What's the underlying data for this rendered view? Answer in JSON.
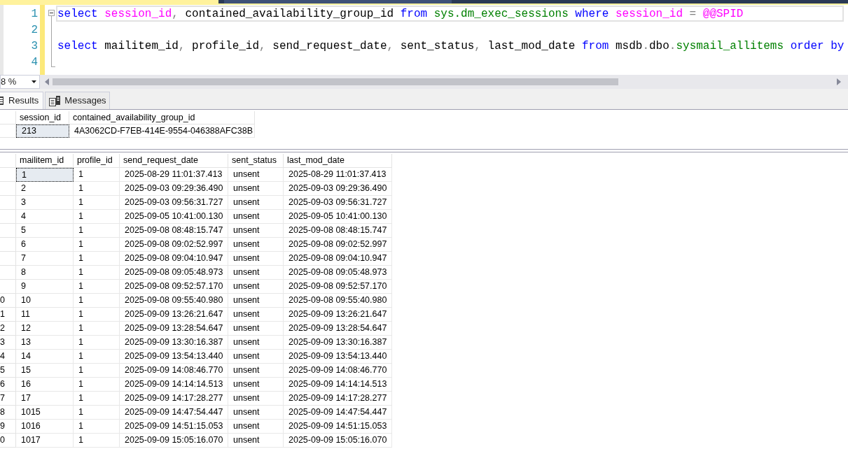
{
  "document_tabs": [
    {
      "selected": true
    },
    {
      "selected": false
    }
  ],
  "editor": {
    "changed": true,
    "fold_region": {
      "expanded": true
    },
    "lines": [
      {
        "number": "1",
        "current": true,
        "tokens": [
          {
            "text": "select",
            "kind": "keyword"
          },
          {
            "text": " session_id",
            "kind": "function"
          },
          {
            "text": ",",
            "kind": "operator"
          },
          {
            "text": " contained_availability_group_id ",
            "kind": "plain"
          },
          {
            "text": "from",
            "kind": "keyword"
          },
          {
            "text": " sys.dm_exec_sessions",
            "kind": "object"
          },
          {
            "text": " where",
            "kind": "keyword"
          },
          {
            "text": " session_id",
            "kind": "function"
          },
          {
            "text": " =",
            "kind": "operator"
          },
          {
            "text": " @@SPID",
            "kind": "function"
          }
        ]
      },
      {
        "number": "2",
        "current": false
      },
      {
        "number": "3",
        "current": false,
        "tokens": [
          {
            "text": "select",
            "kind": "keyword"
          },
          {
            "text": " mailitem_id",
            "kind": "plain"
          },
          {
            "text": ",",
            "kind": "operator"
          },
          {
            "text": " profile_id",
            "kind": "plain"
          },
          {
            "text": ",",
            "kind": "operator"
          },
          {
            "text": " send_request_date",
            "kind": "plain"
          },
          {
            "text": ",",
            "kind": "operator"
          },
          {
            "text": " sent_status",
            "kind": "plain"
          },
          {
            "text": ",",
            "kind": "operator"
          },
          {
            "text": " last_mod_date ",
            "kind": "plain"
          },
          {
            "text": "from",
            "kind": "keyword"
          },
          {
            "text": " msdb",
            "kind": "plain"
          },
          {
            "text": ".",
            "kind": "operator"
          },
          {
            "text": "dbo",
            "kind": "plain"
          },
          {
            "text": ".",
            "kind": "operator"
          },
          {
            "text": "sysmail_allitems",
            "kind": "object"
          },
          {
            "text": " order by",
            "kind": "keyword"
          }
        ]
      },
      {
        "number": "4",
        "current": false
      }
    ]
  },
  "zoom": {
    "value": "8 %"
  },
  "results_tabs": [
    {
      "label": "Results",
      "kind": "results",
      "selected": true
    },
    {
      "label": "Messages",
      "kind": "messages",
      "selected": false
    }
  ],
  "grids": [
    {
      "columns": [
        "session_id",
        "contained_availability_group_id"
      ],
      "rows": [
        {
          "cells": [
            "213",
            "4A3062CD-F7EB-414E-9554-046388AFC38B"
          ],
          "selected": true
        }
      ]
    },
    {
      "columns": [
        "mailitem_id",
        "profile_id",
        "send_request_date",
        "sent_status",
        "last_mod_date"
      ],
      "rows": [
        {
          "cells": [
            "1",
            "1",
            "2025-08-29 11:01:37.413",
            "unsent",
            "2025-08-29 11:01:37.413"
          ],
          "selected": true
        },
        {
          "cells": [
            "2",
            "1",
            "2025-09-03 09:29:36.490",
            "unsent",
            "2025-09-03 09:29:36.490"
          ],
          "selected": false
        },
        {
          "cells": [
            "3",
            "1",
            "2025-09-03 09:56:31.727",
            "unsent",
            "2025-09-03 09:56:31.727"
          ],
          "selected": false
        },
        {
          "cells": [
            "4",
            "1",
            "2025-09-05 10:41:00.130",
            "unsent",
            "2025-09-05 10:41:00.130"
          ],
          "selected": false
        },
        {
          "cells": [
            "5",
            "1",
            "2025-09-08 08:48:15.747",
            "unsent",
            "2025-09-08 08:48:15.747"
          ],
          "selected": false
        },
        {
          "cells": [
            "6",
            "1",
            "2025-09-08 09:02:52.997",
            "unsent",
            "2025-09-08 09:02:52.997"
          ],
          "selected": false
        },
        {
          "cells": [
            "7",
            "1",
            "2025-09-08 09:04:10.947",
            "unsent",
            "2025-09-08 09:04:10.947"
          ],
          "selected": false
        },
        {
          "cells": [
            "8",
            "1",
            "2025-09-08 09:05:48.973",
            "unsent",
            "2025-09-08 09:05:48.973"
          ],
          "selected": false
        },
        {
          "cells": [
            "9",
            "1",
            "2025-09-08 09:52:57.170",
            "unsent",
            "2025-09-08 09:52:57.170"
          ],
          "selected": false
        },
        {
          "row_label": "0",
          "cells": [
            "10",
            "1",
            "2025-09-08 09:55:40.980",
            "unsent",
            "2025-09-08 09:55:40.980"
          ],
          "selected": false
        },
        {
          "row_label": "1",
          "cells": [
            "11",
            "1",
            "2025-09-09 13:26:21.647",
            "unsent",
            "2025-09-09 13:26:21.647"
          ],
          "selected": false
        },
        {
          "row_label": "2",
          "cells": [
            "12",
            "1",
            "2025-09-09 13:28:54.647",
            "unsent",
            "2025-09-09 13:28:54.647"
          ],
          "selected": false
        },
        {
          "row_label": "3",
          "cells": [
            "13",
            "1",
            "2025-09-09 13:30:16.387",
            "unsent",
            "2025-09-09 13:30:16.387"
          ],
          "selected": false
        },
        {
          "row_label": "4",
          "cells": [
            "14",
            "1",
            "2025-09-09 13:54:13.440",
            "unsent",
            "2025-09-09 13:54:13.440"
          ],
          "selected": false
        },
        {
          "row_label": "5",
          "cells": [
            "15",
            "1",
            "2025-09-09 14:08:46.770",
            "unsent",
            "2025-09-09 14:08:46.770"
          ],
          "selected": false
        },
        {
          "row_label": "6",
          "cells": [
            "16",
            "1",
            "2025-09-09 14:14:14.513",
            "unsent",
            "2025-09-09 14:14:14.513"
          ],
          "selected": false
        },
        {
          "row_label": "7",
          "cells": [
            "17",
            "1",
            "2025-09-09 14:17:28.277",
            "unsent",
            "2025-09-09 14:17:28.277"
          ],
          "selected": false
        },
        {
          "row_label": "8",
          "cells": [
            "1015",
            "1",
            "2025-09-09 14:47:54.447",
            "unsent",
            "2025-09-09 14:47:54.447"
          ],
          "selected": false
        },
        {
          "row_label": "9",
          "cells": [
            "1016",
            "1",
            "2025-09-09 14:51:15.053",
            "unsent",
            "2025-09-09 14:51:15.053"
          ],
          "selected": false
        },
        {
          "row_label": "0",
          "cells": [
            "1017",
            "1",
            "2025-09-09 15:05:16.070",
            "unsent",
            "2025-09-09 15:05:16.070"
          ],
          "selected": false
        }
      ]
    }
  ]
}
